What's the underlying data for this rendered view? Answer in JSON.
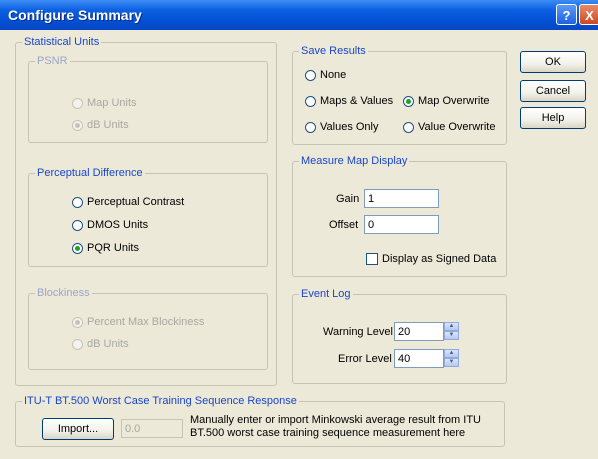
{
  "window": {
    "title": "Configure Summary"
  },
  "titlebar": {
    "help_glyph": "?",
    "close_glyph": "X"
  },
  "stat_units": {
    "legend": "Statistical Units",
    "psnr": {
      "legend": "PSNR",
      "options": [
        "Map Units",
        "dB Units"
      ],
      "selected": "dB Units"
    },
    "perceptual": {
      "legend": "Perceptual Difference",
      "options": [
        "Perceptual Contrast",
        "DMOS Units",
        "PQR Units"
      ],
      "selected": "PQR Units"
    },
    "blockiness": {
      "legend": "Blockiness",
      "options": [
        "Percent Max Blockiness",
        "dB Units"
      ],
      "selected": "Percent Max Blockiness"
    }
  },
  "save_results": {
    "legend": "Save Results",
    "options": [
      "None",
      "Maps & Values",
      "Map Overwrite",
      "Values Only",
      "Value Overwrite"
    ],
    "selected": "Map Overwrite"
  },
  "measure_map": {
    "legend": "Measure Map Display",
    "gain_label": "Gain",
    "gain_value": "1",
    "offset_label": "Offset",
    "offset_value": "0",
    "signed_label": "Display as Signed Data",
    "signed_checked": false
  },
  "event_log": {
    "legend": "Event Log",
    "warning_label": "Warning Level",
    "warning_value": "20",
    "error_label": "Error Level",
    "error_value": "40"
  },
  "itu": {
    "legend": "ITU-T BT.500 Worst Case Training Sequence Response",
    "import_label": "Import...",
    "value": "0.0",
    "description_line1": "Manually enter or import Minkowski average result from ITU",
    "description_line2": "BT.500 worst case training sequence measurement here"
  },
  "buttons": {
    "ok": "OK",
    "cancel": "Cancel",
    "help": "Help"
  },
  "colors": {
    "title_bar": "#0550d5",
    "legend_text": "#1a46c8",
    "dialog_bg": "#ece9d8"
  }
}
